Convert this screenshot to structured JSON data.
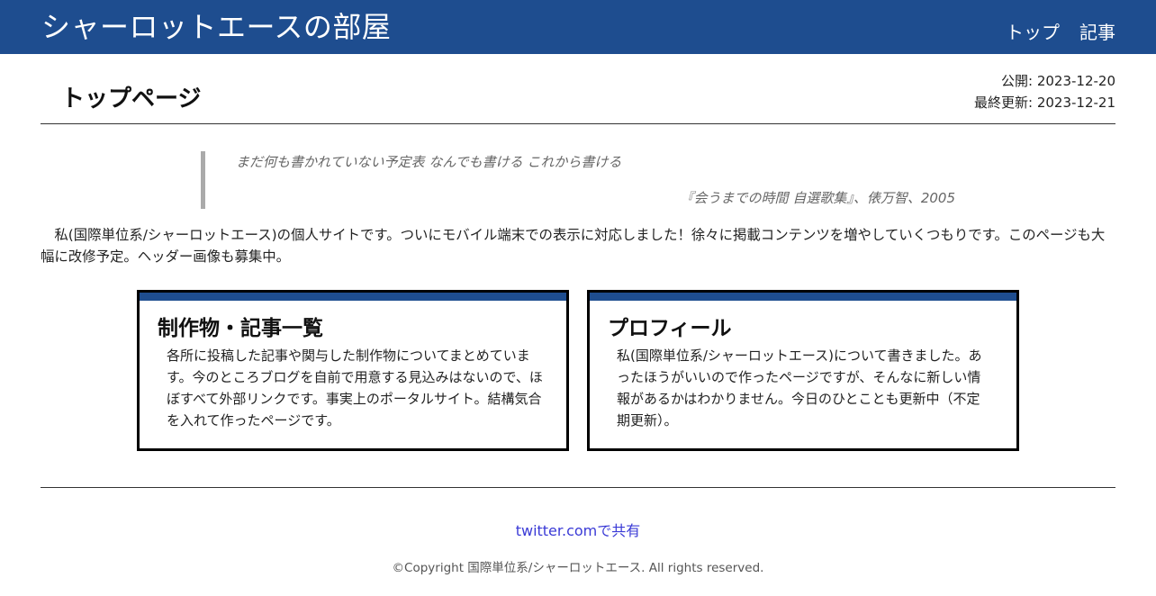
{
  "header": {
    "site_title": "シャーロットエースの部屋",
    "nav": [
      {
        "label": "トップ"
      },
      {
        "label": "記事"
      }
    ]
  },
  "page": {
    "title": "トップページ",
    "published": "公開: 2023-12-20",
    "updated": "最終更新: 2023-12-21"
  },
  "quote": {
    "text": "まだ何も書かれていない予定表 なんでも書ける これから書ける",
    "cite": "『会うまでの時間 自選歌集』、俵万智、2005"
  },
  "intro": "私(国際単位系/シャーロットエース)の個人サイトです。ついにモバイル端末での表示に対応しました！徐々に掲載コンテンツを増やしていくつもりです。このページも大幅に改修予定。ヘッダー画像も募集中。",
  "cards": [
    {
      "title": "制作物・記事一覧",
      "body": "各所に投稿した記事や関与した制作物についてまとめています。今のところブログを自前で用意する見込みはないので、ほぼすべて外部リンクです。事実上のポータルサイト。結構気合を入れて作ったページです。"
    },
    {
      "title": "プロフィール",
      "body": "私(国際単位系/シャーロットエース)について書きました。あったほうがいいので作ったページですが、そんなに新しい情報があるかはわかりません。今日のひとことも更新中（不定期更新）。"
    }
  ],
  "footer": {
    "share_label": "twitter.comで共有",
    "copyright": "©Copyright 国際単位系/シャーロットエース. All rights reserved."
  },
  "colors": {
    "brand": "#1e4d8f",
    "link": "#3a3ad6"
  }
}
